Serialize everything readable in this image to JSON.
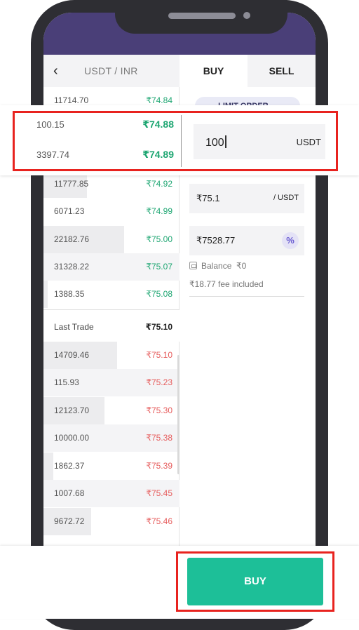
{
  "pair": {
    "title": "USDT / INR"
  },
  "tabs": {
    "buy": "BUY",
    "sell": "SELL"
  },
  "order_type": "LIMIT ORDER",
  "order_book": {
    "sell_top": [
      {
        "qty": "11714.70",
        "price": "₹74.84"
      },
      {
        "qty": "100.15",
        "price": "₹74.88"
      },
      {
        "qty": "3397.74",
        "price": "₹74.89"
      },
      {
        "qty": "11777.85",
        "price": "₹74.92"
      },
      {
        "qty": "6071.23",
        "price": "₹74.99"
      },
      {
        "qty": "22182.76",
        "price": "₹75.00"
      },
      {
        "qty": "31328.22",
        "price": "₹75.07"
      },
      {
        "qty": "1388.35",
        "price": "₹75.08"
      }
    ],
    "last_trade_label": "Last Trade",
    "last_trade_price": "₹75.10",
    "buy_side": [
      {
        "qty": "14709.46",
        "price": "₹75.10"
      },
      {
        "qty": "115.93",
        "price": "₹75.23"
      },
      {
        "qty": "12123.70",
        "price": "₹75.30"
      },
      {
        "qty": "10000.00",
        "price": "₹75.38"
      },
      {
        "qty": "1862.37",
        "price": "₹75.39"
      },
      {
        "qty": "1007.68",
        "price": "₹75.45"
      },
      {
        "qty": "9672.72",
        "price": "₹75.46"
      }
    ]
  },
  "form": {
    "amount_value": "100",
    "amount_unit": "USDT",
    "price_value": "₹75.1",
    "price_unit": "/ USDT",
    "total_value": "₹7528.77",
    "percent_label": "%",
    "balance_label": "Balance",
    "balance_value": "₹0",
    "fee_text": "₹18.77 fee included"
  },
  "buy_button": "BUY",
  "colors": {
    "accent": "#1dbf98",
    "header": "#4a3f78",
    "green": "#1ea672",
    "red": "#e65c5c",
    "highlight": "#e8231f"
  },
  "icons": {
    "back": "chevron-left-icon",
    "dropdown": "chevron-down-icon",
    "wallet": "wallet-icon"
  }
}
